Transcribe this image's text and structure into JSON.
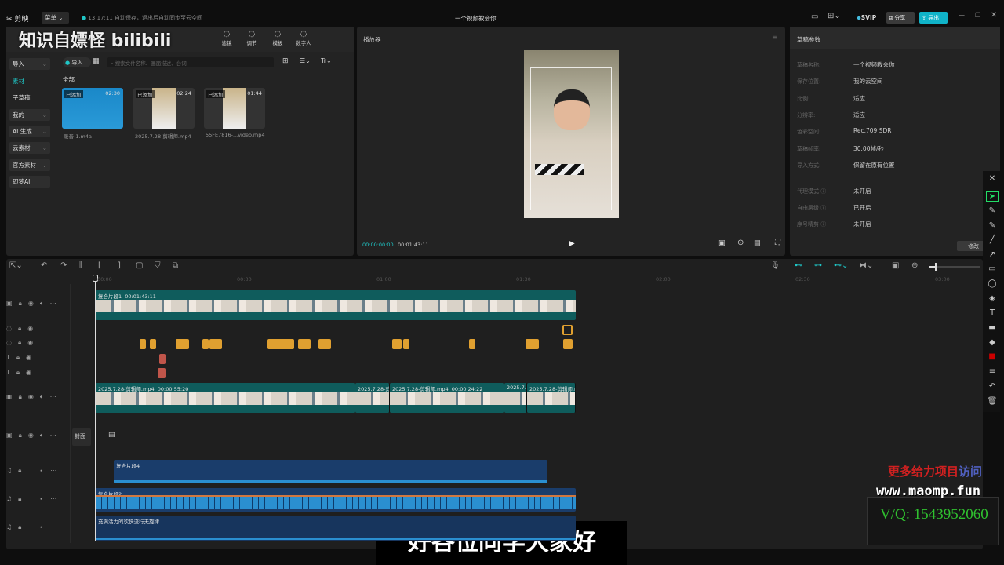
{
  "titlebar": {
    "logo": "剪映",
    "menu": "菜单",
    "autosave": "13:17:11 自动保存，退出后自动同步至云空间",
    "title": "一个视频教会你",
    "svip": "SVIP",
    "share": "分享",
    "export": "导出"
  },
  "watermark_top": "知识自嫖怪 bilibili",
  "media_toolbar": [
    {
      "label": "滤镜",
      "icon": "filter-icon"
    },
    {
      "label": "调节",
      "icon": "adjust-icon"
    },
    {
      "label": "模板",
      "icon": "template-icon"
    },
    {
      "label": "数字人",
      "icon": "digital-human-icon"
    }
  ],
  "sidebar": {
    "items": [
      {
        "label": "导入",
        "selected": true
      },
      {
        "label": "素材",
        "active": true
      },
      {
        "label": "子草稿"
      },
      {
        "label": "我的"
      },
      {
        "label": "AI 生成"
      },
      {
        "label": "云素材"
      },
      {
        "label": "官方素材"
      },
      {
        "label": "即梦AI"
      }
    ]
  },
  "media": {
    "import": "导入",
    "search_placeholder": "搜索文件名称、画面描述、台词",
    "filter": "全部",
    "items": [
      {
        "tag": "已添加",
        "duration": "02:30",
        "name": "录音-1.m4a"
      },
      {
        "tag": "已添加",
        "duration": "02:24",
        "name": "2025.7.28-剪辑师.mp4"
      },
      {
        "tag": "已添加",
        "duration": "01:44",
        "name": "55FE7816-...video.mp4"
      }
    ]
  },
  "player": {
    "title": "播放器",
    "current": "00:00:00:00",
    "total": "00:01:43:11"
  },
  "properties": {
    "title": "草稿参数",
    "rows": [
      {
        "label": "草稿名称:",
        "value": "一个视频教会你"
      },
      {
        "label": "保存位置:",
        "value": "我的云空间"
      },
      {
        "label": "比例:",
        "value": "适应"
      },
      {
        "label": "分辨率:",
        "value": "适应"
      },
      {
        "label": "色彩空间:",
        "value": "Rec.709 SDR"
      },
      {
        "label": "草稿帧率:",
        "value": "30.00帧/秒"
      },
      {
        "label": "导入方式:",
        "value": "保留在原有位置"
      }
    ],
    "rows2": [
      {
        "label": "代理模式",
        "value": "未开启"
      },
      {
        "label": "自由层级",
        "value": "已开启"
      },
      {
        "label": "序号精剪",
        "value": "未开启"
      }
    ],
    "edit": "修改"
  },
  "timeline": {
    "ticks": [
      "00:00",
      "00:30",
      "01:00",
      "01:30",
      "02:00",
      "02:30",
      "03:00"
    ],
    "main_clip": {
      "name": "复合片段1",
      "duration": "00:01:43:11"
    },
    "video2": [
      {
        "name": "2025.7.28-剪辑师.mp4",
        "duration": "00:00:55:20"
      },
      {
        "name": "2025.7.28-剪"
      },
      {
        "name": "2025.7.28-剪辑师.mp4",
        "duration": "00:00:24:22"
      },
      {
        "name": "2025.7."
      },
      {
        "name": "2025.7.28-剪辑师.m"
      }
    ],
    "cover": "封面",
    "audio": [
      {
        "name": "复合片段4"
      },
      {
        "name": "复合片段2"
      },
      {
        "name": "充满活力的欢快流行无旋律"
      }
    ]
  },
  "subtitle": "好各位同学大家好",
  "watermark_br": {
    "line1a": "更多给力项目",
    "line1b": "访问",
    "url": "www.maomp.fun",
    "contact": "V/Q: 1543952060"
  },
  "colors": {
    "accent": "#1fc7c7",
    "export": "#10b3c8",
    "clip": "#0f5c5c",
    "sticker": "#e0a030",
    "audio": "#1a3d6b"
  }
}
